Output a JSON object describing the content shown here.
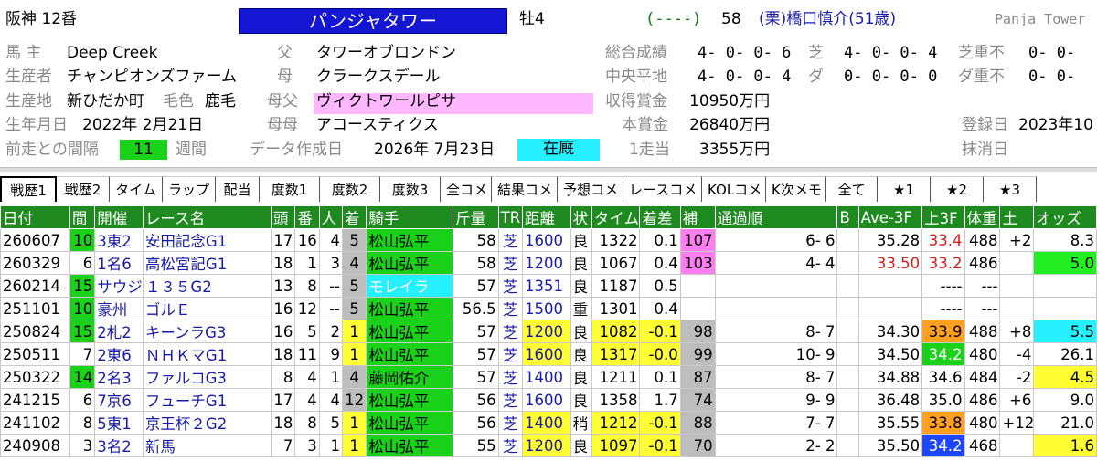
{
  "header": {
    "venue_race": "阪神 12番",
    "horse_name": "パンジャタワー",
    "sex_age": "牡4",
    "odds_blank": "(----)",
    "weight_carried": "58",
    "jockey_line": "(栗)橋口慎介(51歳)",
    "english_name": "Panja Tower",
    "owner_label": "馬 主",
    "owner": "Deep Creek",
    "breeder_label": "生産者",
    "breeder": "チャンピオンズファーム",
    "birthplace_label": "生産地",
    "birthplace": "新ひだか町",
    "coat_label": "毛色",
    "coat": "鹿毛",
    "birthdate_label": "生年月日",
    "birthdate": "2022年 2月21日",
    "interval_label": "前走との間隔",
    "interval": "11",
    "interval_unit": "週間",
    "sire_label": "父",
    "sire": "タワーオブロンドン",
    "dam_label": "母",
    "dam": "クラークスデール",
    "damsire_label": "母父",
    "damsire": "ヴィクトワールピサ",
    "granddam_label": "母母",
    "granddam": "アコースティクス",
    "data_date_label": "データ作成日",
    "data_date": "2026年 7月23日",
    "status": "在厩",
    "total_label": "総合成績",
    "total": "4- 0- 0- 6",
    "turf_label": "芝",
    "turf": "4- 0- 0- 4",
    "turf_heavy_label": "芝重不",
    "turf_heavy": "0- 0-",
    "central_flat_label": "中央平地",
    "central_flat": "4- 0- 0- 4",
    "dirt_label": "ダ",
    "dirt": "0- 0- 0- 0",
    "dirt_heavy_label": "ダ重不",
    "dirt_heavy": "0- 0-",
    "earnings_label": "収得賞金",
    "earnings": "10950万円",
    "main_prize_label": "本賞金",
    "main_prize": "26840万円",
    "per_start_label": "1走当",
    "per_start": "3355万円",
    "registered_label": "登録日",
    "registered": "2023年10",
    "deleted_label": "抹消日"
  },
  "tabs": [
    "戦歴1",
    "戦歴2",
    "タイム",
    "ラップ",
    "配当",
    "度数1",
    "度数2",
    "度数3",
    "全コメ",
    "結果コメ",
    "予想コメ",
    "レースコメ",
    "KOLコメ",
    "K次メモ",
    "全て",
    "★1",
    "★2",
    "★3"
  ],
  "columns": [
    "日付",
    "間",
    "開催",
    "レース名",
    "頭",
    "番",
    "人",
    "着",
    "騎手",
    "斤量",
    "TR",
    "距離",
    "状",
    "タイム",
    "着差",
    "補",
    "通過順",
    "B",
    "Ave-3F",
    "上3F",
    "体重",
    "土",
    "オッズ"
  ],
  "rows": [
    {
      "date": "260607",
      "gap": "10",
      "kaisai": "3東2",
      "race": "安田記念G1",
      "heads": "17",
      "num": "16",
      "pop": "4",
      "place": "5",
      "jockey": "松山弘平",
      "kin": "58",
      "tr": "芝",
      "dist": "1600",
      "cond": "良",
      "time": "1322",
      "margin": "0.1",
      "ho": "107",
      "pass": "6- 6",
      "b": "",
      "ave": "35.28",
      "up3": "33.4",
      "wt": "488",
      "diff": "+2",
      "odds": "8.3"
    },
    {
      "date": "260329",
      "gap": "6",
      "kaisai": "1名6",
      "race": "高松宮記G1",
      "heads": "18",
      "num": "1",
      "pop": "3",
      "place": "4",
      "jockey": "松山弘平",
      "kin": "58",
      "tr": "芝",
      "dist": "1200",
      "cond": "良",
      "time": "1067",
      "margin": "0.4",
      "ho": "103",
      "pass": "4- 4",
      "b": "",
      "ave": "33.50",
      "up3": "33.2",
      "wt": "486",
      "diff": "",
      "odds": "5.0"
    },
    {
      "date": "260214",
      "gap": "15",
      "kaisai": "サウジ",
      "race": "１３５G2",
      "heads": "13",
      "num": "8",
      "pop": "--",
      "place": "5",
      "jockey": "モレイラ",
      "kin": "57",
      "tr": "芝",
      "dist": "1351",
      "cond": "良",
      "time": "1187",
      "margin": "0.5",
      "ho": "",
      "pass": "",
      "b": "",
      "ave": "",
      "up3": "----",
      "wt": "---",
      "diff": "",
      "odds": ""
    },
    {
      "date": "251101",
      "gap": "10",
      "kaisai": "豪州",
      "race": "ゴルＥ",
      "heads": "16",
      "num": "12",
      "pop": "--",
      "place": "5",
      "jockey": "松山弘平",
      "kin": "56.5",
      "tr": "芝",
      "dist": "1500",
      "cond": "重",
      "time": "1301",
      "margin": "0.4",
      "ho": "",
      "pass": "",
      "b": "",
      "ave": "",
      "up3": "----",
      "wt": "---",
      "diff": "",
      "odds": ""
    },
    {
      "date": "250824",
      "gap": "15",
      "kaisai": "2札2",
      "race": "キーンラG3",
      "heads": "16",
      "num": "5",
      "pop": "2",
      "place": "1",
      "jockey": "松山弘平",
      "kin": "57",
      "tr": "芝",
      "dist": "1200",
      "cond": "良",
      "time": "1082",
      "margin": "-0.1",
      "ho": "98",
      "pass": "8- 7",
      "b": "",
      "ave": "34.30",
      "up3": "33.9",
      "wt": "488",
      "diff": "+8",
      "odds": "5.5"
    },
    {
      "date": "250511",
      "gap": "7",
      "kaisai": "2東6",
      "race": "ＮＨＫマG1",
      "heads": "18",
      "num": "11",
      "pop": "9",
      "place": "1",
      "jockey": "松山弘平",
      "kin": "57",
      "tr": "芝",
      "dist": "1600",
      "cond": "良",
      "time": "1317",
      "margin": "-0.0",
      "ho": "99",
      "pass": "10- 9",
      "b": "",
      "ave": "34.50",
      "up3": "34.2",
      "wt": "480",
      "diff": "-4",
      "odds": "26.1"
    },
    {
      "date": "250322",
      "gap": "14",
      "kaisai": "2名3",
      "race": "ファルコG3",
      "heads": "8",
      "num": "4",
      "pop": "1",
      "place": "4",
      "jockey": "藤岡佑介",
      "kin": "57",
      "tr": "芝",
      "dist": "1400",
      "cond": "良",
      "time": "1211",
      "margin": "0.1",
      "ho": "87",
      "pass": "8- 7",
      "b": "",
      "ave": "34.88",
      "up3": "34.6",
      "wt": "484",
      "diff": "-2",
      "odds": "4.5"
    },
    {
      "date": "241215",
      "gap": "6",
      "kaisai": "7京6",
      "race": "フューチG1",
      "heads": "17",
      "num": "4",
      "pop": "4",
      "place": "12",
      "jockey": "松山弘平",
      "kin": "56",
      "tr": "芝",
      "dist": "1600",
      "cond": "良",
      "time": "1358",
      "margin": "1.7",
      "ho": "74",
      "pass": "9- 9",
      "b": "",
      "ave": "36.48",
      "up3": "35.0",
      "wt": "486",
      "diff": "+6",
      "odds": "9.0"
    },
    {
      "date": "241102",
      "gap": "8",
      "kaisai": "5東1",
      "race": "京王杯２G2",
      "heads": "18",
      "num": "8",
      "pop": "5",
      "place": "1",
      "jockey": "松山弘平",
      "kin": "56",
      "tr": "芝",
      "dist": "1400",
      "cond": "稍",
      "time": "1212",
      "margin": "-0.1",
      "ho": "88",
      "pass": "7- 7",
      "b": "",
      "ave": "35.55",
      "up3": "33.8",
      "wt": "480",
      "diff": "+12",
      "odds": "21.0"
    },
    {
      "date": "240908",
      "gap": "3",
      "kaisai": "3名2",
      "race": "新馬",
      "heads": "7",
      "num": "3",
      "pop": "1",
      "place": "1",
      "jockey": "松山弘平",
      "kin": "55",
      "tr": "芝",
      "dist": "1200",
      "cond": "良",
      "time": "1097",
      "margin": "-0.1",
      "ho": "70",
      "pass": "2- 2",
      "b": "",
      "ave": "35.50",
      "up3": "34.2",
      "wt": "468",
      "diff": "",
      "odds": "1.6"
    }
  ],
  "colors": {
    "header_green": "#1f8a1f",
    "jockey_green": "#1ad21a",
    "cyan": "#26f0ff",
    "pink": "#ff7ef0",
    "yellow": "#ffff33",
    "orange": "#ffa020",
    "blue_up": "#1e46ff",
    "grey_place": "#bdbdbd",
    "gap_green": "#1ad21a"
  }
}
